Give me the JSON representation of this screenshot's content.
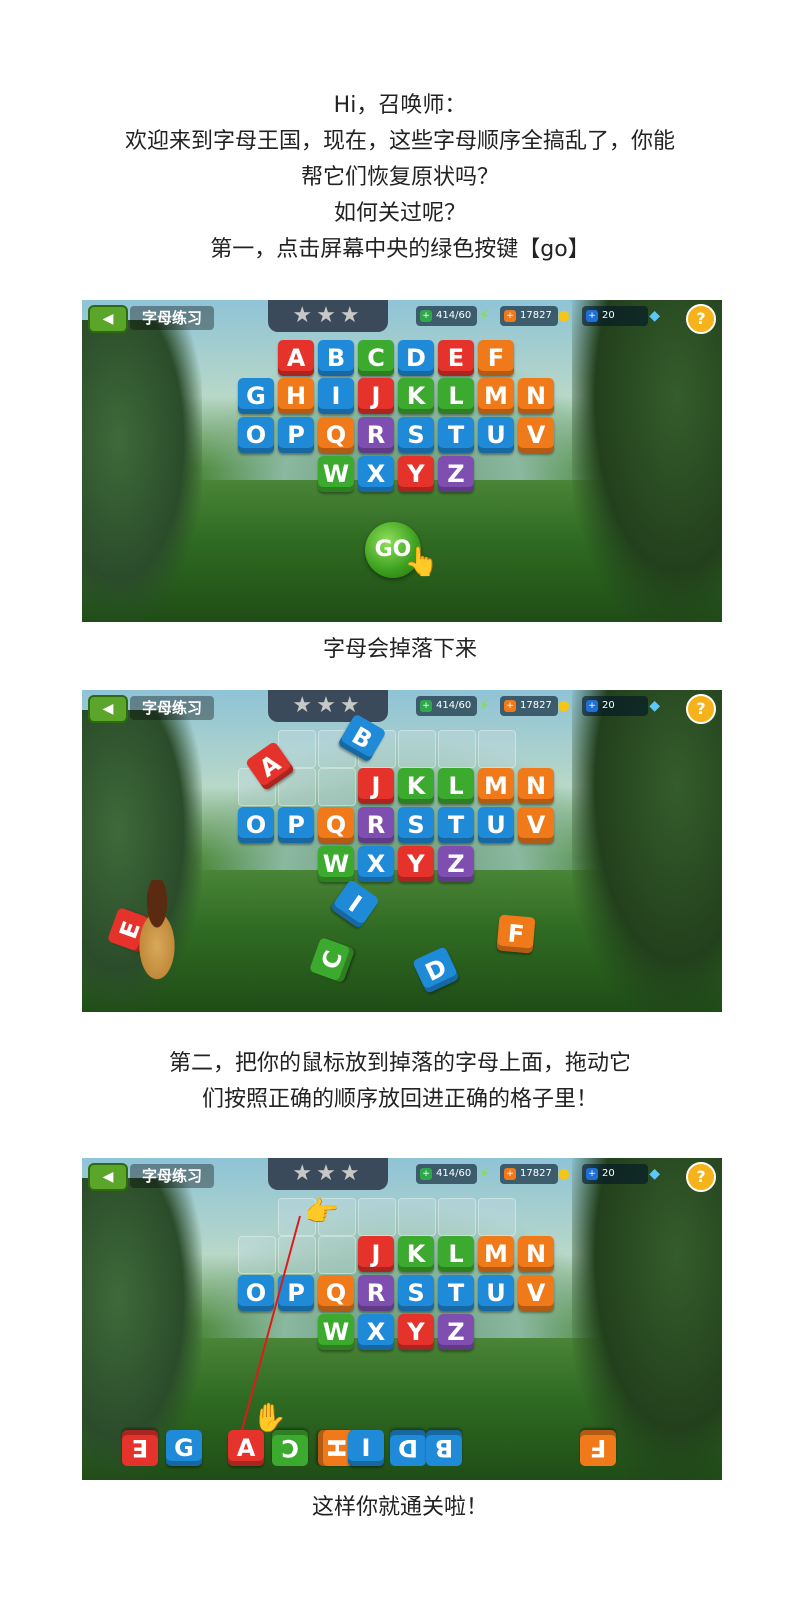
{
  "intro": {
    "lines": [
      "Hi，召唤师：",
      "欢迎来到字母王国，现在，这些字母顺序全搞乱了，你能",
      "帮它们恢复原状吗？",
      "如何关过呢？",
      "第一，点击屏幕中央的绿色按键【go】"
    ]
  },
  "caption1": "字母会掉落下来",
  "step2": {
    "lines": [
      "第二，把你的鼠标放到掉落的字母上面，拖动它",
      "们按照正确的顺序放回进正确的格子里！"
    ]
  },
  "caption_end": "这样你就通关啦！",
  "game_ui": {
    "back_label": "◀",
    "title": "字母练习",
    "stars": "★★★",
    "energy": "414/60",
    "coins": "17827",
    "gems": "20",
    "help": "?",
    "go_label": "GO",
    "energy_icon": "lightning-icon",
    "coin_icon": "coin-icon",
    "gem_icon": "diamond-icon"
  },
  "letters": {
    "row1": [
      "A",
      "B",
      "C",
      "D",
      "E",
      "F"
    ],
    "row2": [
      "G",
      "H",
      "I",
      "J",
      "K",
      "L",
      "M",
      "N"
    ],
    "row3": [
      "O",
      "P",
      "Q",
      "R",
      "S",
      "T",
      "U",
      "V"
    ],
    "row4": [
      "W",
      "X",
      "Y",
      "Z"
    ],
    "remaining_row2": [
      "J",
      "K",
      "L",
      "M",
      "N"
    ],
    "fallen_screen2": [
      "A",
      "B",
      "I",
      "C",
      "D",
      "F",
      "E"
    ],
    "bottom_screen3": [
      "E",
      "G",
      "A",
      "C",
      "H",
      "I",
      "D",
      "B",
      "F"
    ]
  },
  "colors": {
    "red": "#e5322b",
    "blue": "#1f8ad8",
    "green": "#3caa2e",
    "orange": "#f07a1a",
    "purple": "#7e4fb0",
    "go_green": "#3c9e1e"
  }
}
